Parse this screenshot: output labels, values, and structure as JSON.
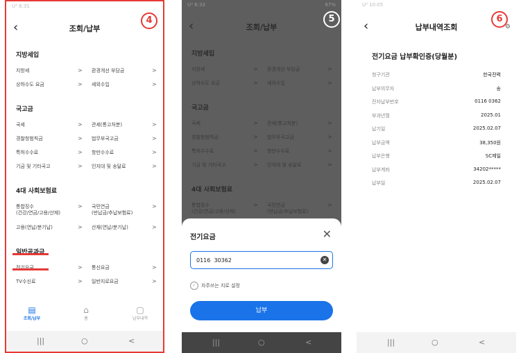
{
  "screen1": {
    "status": "U³ 6:31",
    "badge": "4",
    "title": "조회/납부",
    "sections": [
      {
        "title": "지방세입",
        "rows": [
          [
            "지방세",
            "환경개선 부담금"
          ],
          [
            "상하수도 요금",
            "세외수입"
          ]
        ]
      },
      {
        "title": "국고금",
        "rows": [
          [
            "국세",
            "관세(통고처분)"
          ],
          [
            "경찰청범칙금",
            "법무부국고금"
          ],
          [
            "특허수수료",
            "항만수수료"
          ],
          [
            "기금 및 기타국고",
            "인지대 및 송달료"
          ]
        ]
      },
      {
        "title": "4대 사회보험료",
        "rows": [
          [
            "통합징수\n(건강/연금/고용/산재)",
            "국민연금\n(반납금/추납보험료)"
          ],
          [
            "고용(연납/분기납)",
            "산재(연납/분기납)"
          ]
        ]
      },
      {
        "title": "일반공과금",
        "rows": [
          [
            "전기요금",
            "통신요금"
          ],
          [
            "TV수신료",
            "일반지로요금"
          ]
        ]
      }
    ],
    "nav": [
      "조회/납부",
      "홈",
      "납부내역"
    ]
  },
  "screen2": {
    "status": "U³ 6:33",
    "status_right": "67%",
    "badge": "5",
    "title": "조회/납부",
    "sections": [
      {
        "title": "지방세입",
        "rows": [
          [
            "지방세",
            "환경개선 부담금"
          ],
          [
            "상하수도 요금",
            "세외수입"
          ]
        ]
      },
      {
        "title": "국고금",
        "rows": [
          [
            "국세",
            "관세(통고처분)"
          ],
          [
            "경찰청범칙금",
            "법무부국고금"
          ],
          [
            "특허수수료",
            "항만수수료"
          ],
          [
            "기금 및 기타국고",
            "인지대 및 송달료"
          ]
        ]
      },
      {
        "title": "4대 사회보험료",
        "rows": [
          [
            "통합징수\n(건강/연금/고용/산재)",
            "국민연금\n(반납금/추납보험료)"
          ]
        ]
      }
    ],
    "sheet": {
      "title": "전기요금",
      "account_value": "0116  30362",
      "favorite_label": "자주쓰는 지로 설정",
      "pay_label": "납부"
    }
  },
  "screen3": {
    "status": "U³ 10:05",
    "badge": "6",
    "title": "납부내역조회",
    "heading": "전기요금 납부확인증(당월분)",
    "fields": [
      {
        "label": "청구기관",
        "value": "한국전력"
      },
      {
        "label": "납부의무자",
        "value": "송"
      },
      {
        "label": "전자납부번호",
        "value": "0116    0362"
      },
      {
        "label": "부과년월",
        "value": "2025.01"
      },
      {
        "label": "납기일",
        "value": "2025.02.07"
      },
      {
        "label": "납부금액",
        "value": "38,350원"
      },
      {
        "label": "납부은행",
        "value": "SC제일"
      },
      {
        "label": "납부계좌",
        "value": "34202*****"
      },
      {
        "label": "납부일",
        "value": "2025.02.07"
      }
    ]
  },
  "system_nav": [
    "|||",
    "○",
    "<"
  ],
  "colors": {
    "accent": "#1a73e8",
    "highlight": "#e53935",
    "dim": "#5e5e5e"
  }
}
